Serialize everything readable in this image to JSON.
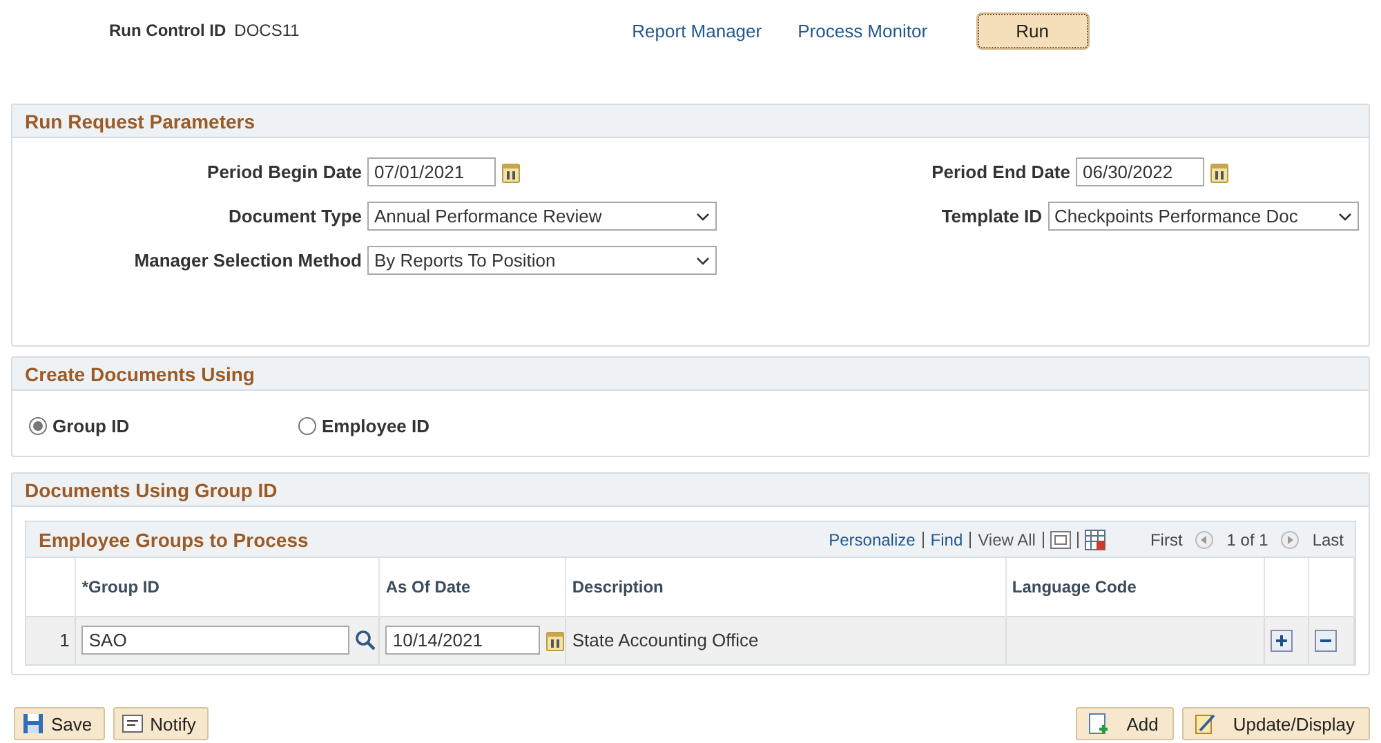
{
  "run_control": {
    "label": "Run Control ID",
    "value": "DOCS11"
  },
  "links": [
    {
      "label": "Report Manager"
    },
    {
      "label": "Process Monitor"
    }
  ],
  "run_button": {
    "label": "Run"
  },
  "run_request_parameters": {
    "title": "Run Request Parameters",
    "fields": [
      {
        "label": "Period Begin Date",
        "value": "07/01/2021",
        "kind": "date"
      },
      {
        "label": "Period End Date",
        "value": "06/30/2022",
        "kind": "date"
      },
      {
        "label": "Document Type",
        "value": "Annual Performance Review",
        "kind": "select"
      },
      {
        "label": "Template ID",
        "value": "Checkpoints Performance Doc",
        "kind": "select"
      },
      {
        "label": "Manager Selection Method",
        "value": "By Reports To Position",
        "kind": "select"
      }
    ]
  },
  "create_documents_using": {
    "title": "Create Documents Using",
    "options": [
      {
        "label": "Group ID",
        "selected": true
      },
      {
        "label": "Employee ID",
        "selected": false
      }
    ]
  },
  "documents_using_group_id": {
    "title": "Documents Using Group ID",
    "grid": {
      "title": "Employee Groups to Process",
      "toolbar_links": [
        {
          "label": "Personalize",
          "disabled": false
        },
        {
          "label": "Find",
          "disabled": false
        },
        {
          "label": "View All",
          "disabled": true
        }
      ],
      "first": "First",
      "count": "1 of 1",
      "last": "Last",
      "columns": [
        "*Group ID",
        "As Of Date",
        "Description",
        "Language Code"
      ],
      "rows": [
        {
          "number": "1",
          "group_id": "SAO",
          "as_of_date": "10/14/2021",
          "description": "State Accounting Office"
        }
      ]
    }
  },
  "footer": {
    "left": [
      {
        "label": "Save",
        "kind": "save"
      },
      {
        "label": "Notify",
        "kind": "notify"
      }
    ],
    "right": [
      {
        "label": "Add",
        "kind": "add"
      },
      {
        "label": "Update/Display",
        "kind": "update"
      }
    ]
  }
}
